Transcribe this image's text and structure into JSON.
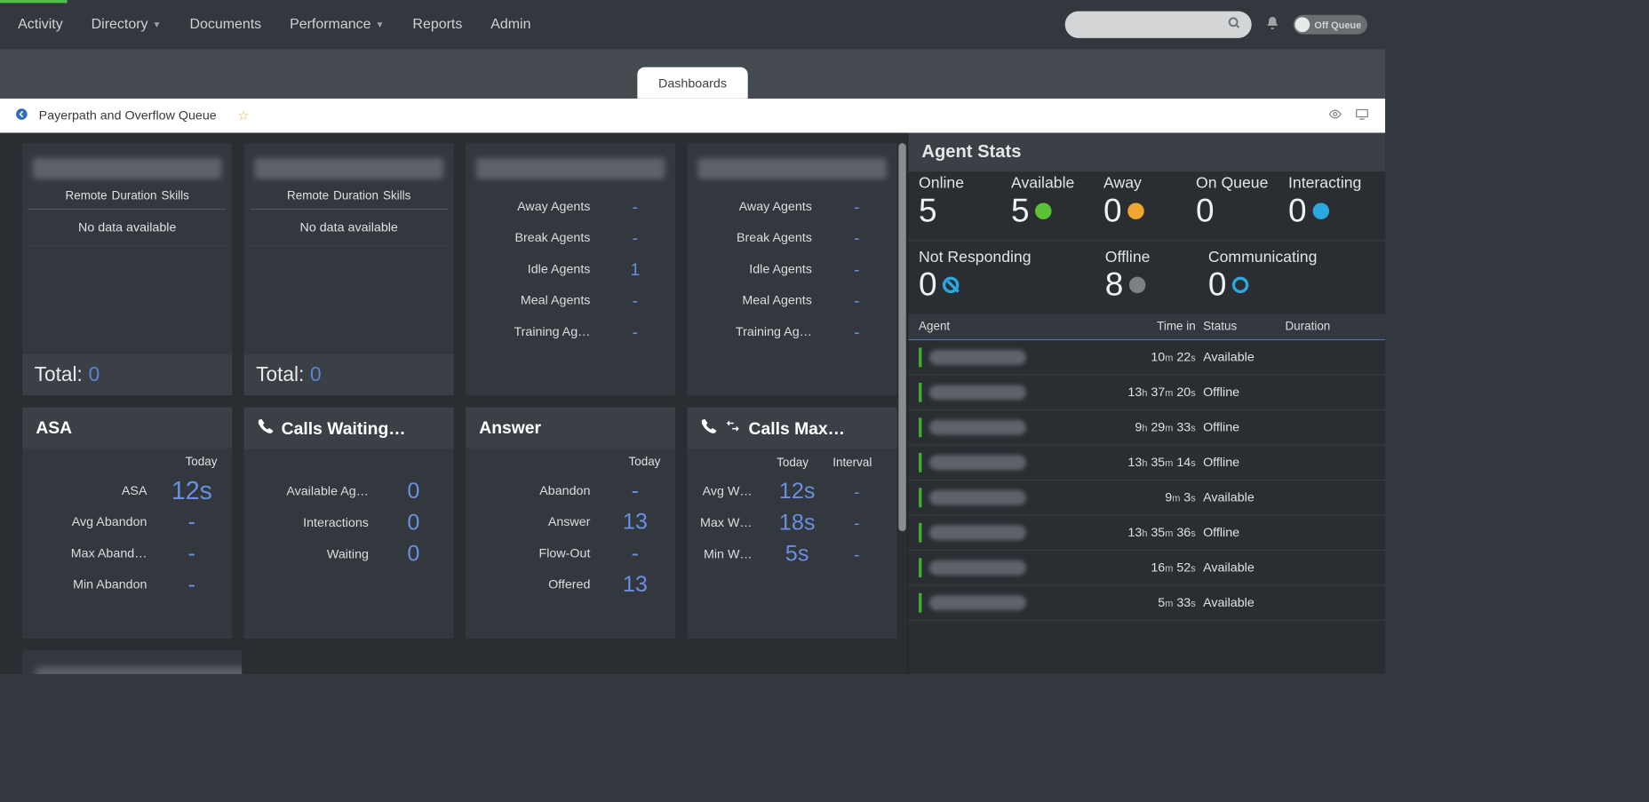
{
  "nav": {
    "activity": "Activity",
    "directory": "Directory",
    "documents": "Documents",
    "performance": "Performance",
    "reports": "Reports",
    "admin": "Admin",
    "search_placeholder": "",
    "toggle_label": "Off Queue"
  },
  "tab": {
    "label": "Dashboards"
  },
  "breadcrumb": {
    "title": "Payerpath and Overflow Queue"
  },
  "widgets": {
    "queue1": {
      "headers": [
        "Remote",
        "Duration",
        "Skills"
      ],
      "nodata": "No data available",
      "total_label": "Total:",
      "total_value": "0"
    },
    "queue2": {
      "headers": [
        "Remote",
        "Duration",
        "Skills"
      ],
      "nodata": "No data available",
      "total_label": "Total:",
      "total_value": "0"
    },
    "agentStatus1": {
      "rows": [
        {
          "label": "Away Agents",
          "value": "-"
        },
        {
          "label": "Break Agents",
          "value": "-"
        },
        {
          "label": "Idle Agents",
          "value": "1"
        },
        {
          "label": "Meal Agents",
          "value": "-"
        },
        {
          "label": "Training Ag…",
          "value": "-"
        }
      ]
    },
    "agentStatus2": {
      "rows": [
        {
          "label": "Away Agents",
          "value": "-"
        },
        {
          "label": "Break Agents",
          "value": "-"
        },
        {
          "label": "Idle Agents",
          "value": "-"
        },
        {
          "label": "Meal Agents",
          "value": "-"
        },
        {
          "label": "Training Ag…",
          "value": "-"
        }
      ]
    },
    "asa": {
      "title": "ASA",
      "col": "Today",
      "rows": [
        {
          "label": "ASA",
          "value": "12s"
        },
        {
          "label": "Avg Abandon",
          "value": "-"
        },
        {
          "label": "Max Aband…",
          "value": "-"
        },
        {
          "label": "Min Abandon",
          "value": "-"
        }
      ]
    },
    "callsWaiting": {
      "title": "Calls Waiting…",
      "rows": [
        {
          "label": "Available Ag…",
          "value": "0"
        },
        {
          "label": "Interactions",
          "value": "0"
        },
        {
          "label": "Waiting",
          "value": "0"
        }
      ]
    },
    "answer": {
      "title": "Answer",
      "col": "Today",
      "rows": [
        {
          "label": "Abandon",
          "value": "-"
        },
        {
          "label": "Answer",
          "value": "13"
        },
        {
          "label": "Flow-Out",
          "value": "-"
        },
        {
          "label": "Offered",
          "value": "13"
        }
      ]
    },
    "callsMax": {
      "title": "Calls Max…",
      "col1": "Today",
      "col2": "Interval",
      "rows": [
        {
          "label": "Avg W…",
          "c1": "12s",
          "c2": "-"
        },
        {
          "label": "Max W…",
          "c1": "18s",
          "c2": "-"
        },
        {
          "label": "Min W…",
          "c1": "5s",
          "c2": "-"
        }
      ]
    }
  },
  "agentStats": {
    "title": "Agent Stats",
    "top": {
      "online": {
        "label": "Online",
        "value": "5"
      },
      "available": {
        "label": "Available",
        "value": "5"
      },
      "away": {
        "label": "Away",
        "value": "0"
      },
      "onqueue": {
        "label": "On Queue",
        "value": "0"
      },
      "interacting": {
        "label": "Interacting",
        "value": "0"
      }
    },
    "bottom": {
      "notResponding": {
        "label": "Not Responding",
        "value": "0"
      },
      "offline": {
        "label": "Offline",
        "value": "8"
      },
      "communicating": {
        "label": "Communicating",
        "value": "0"
      }
    },
    "tableHeaders": {
      "agent": "Agent",
      "time": "Time in",
      "status": "Status",
      "duration": "Duration"
    },
    "rows": [
      {
        "time": "10m 22s",
        "status": "Available"
      },
      {
        "time": "13h 37m 20s",
        "status": "Offline"
      },
      {
        "time": "9h 29m 33s",
        "status": "Offline"
      },
      {
        "time": "13h 35m 14s",
        "status": "Offline"
      },
      {
        "time": "9m 3s",
        "status": "Available"
      },
      {
        "time": "13h 35m 36s",
        "status": "Offline"
      },
      {
        "time": "16m 52s",
        "status": "Available"
      },
      {
        "time": "5m 33s",
        "status": "Available"
      }
    ]
  }
}
